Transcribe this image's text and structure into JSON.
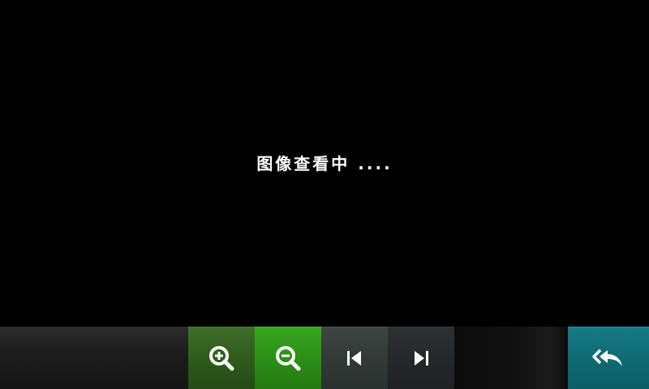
{
  "viewer": {
    "status_text": "图像查看中 ...."
  },
  "toolbar": {
    "zoom_in": {
      "icon": "zoom-in-icon",
      "color": "#2f5c1d"
    },
    "zoom_out": {
      "icon": "zoom-out-icon",
      "color": "#2c8f17"
    },
    "previous": {
      "icon": "skip-previous-icon",
      "color": "#323a37"
    },
    "next": {
      "icon": "skip-next-icon",
      "color": "#25282a"
    },
    "back": {
      "icon": "reply-all-icon",
      "color": "#0f6a74"
    }
  }
}
